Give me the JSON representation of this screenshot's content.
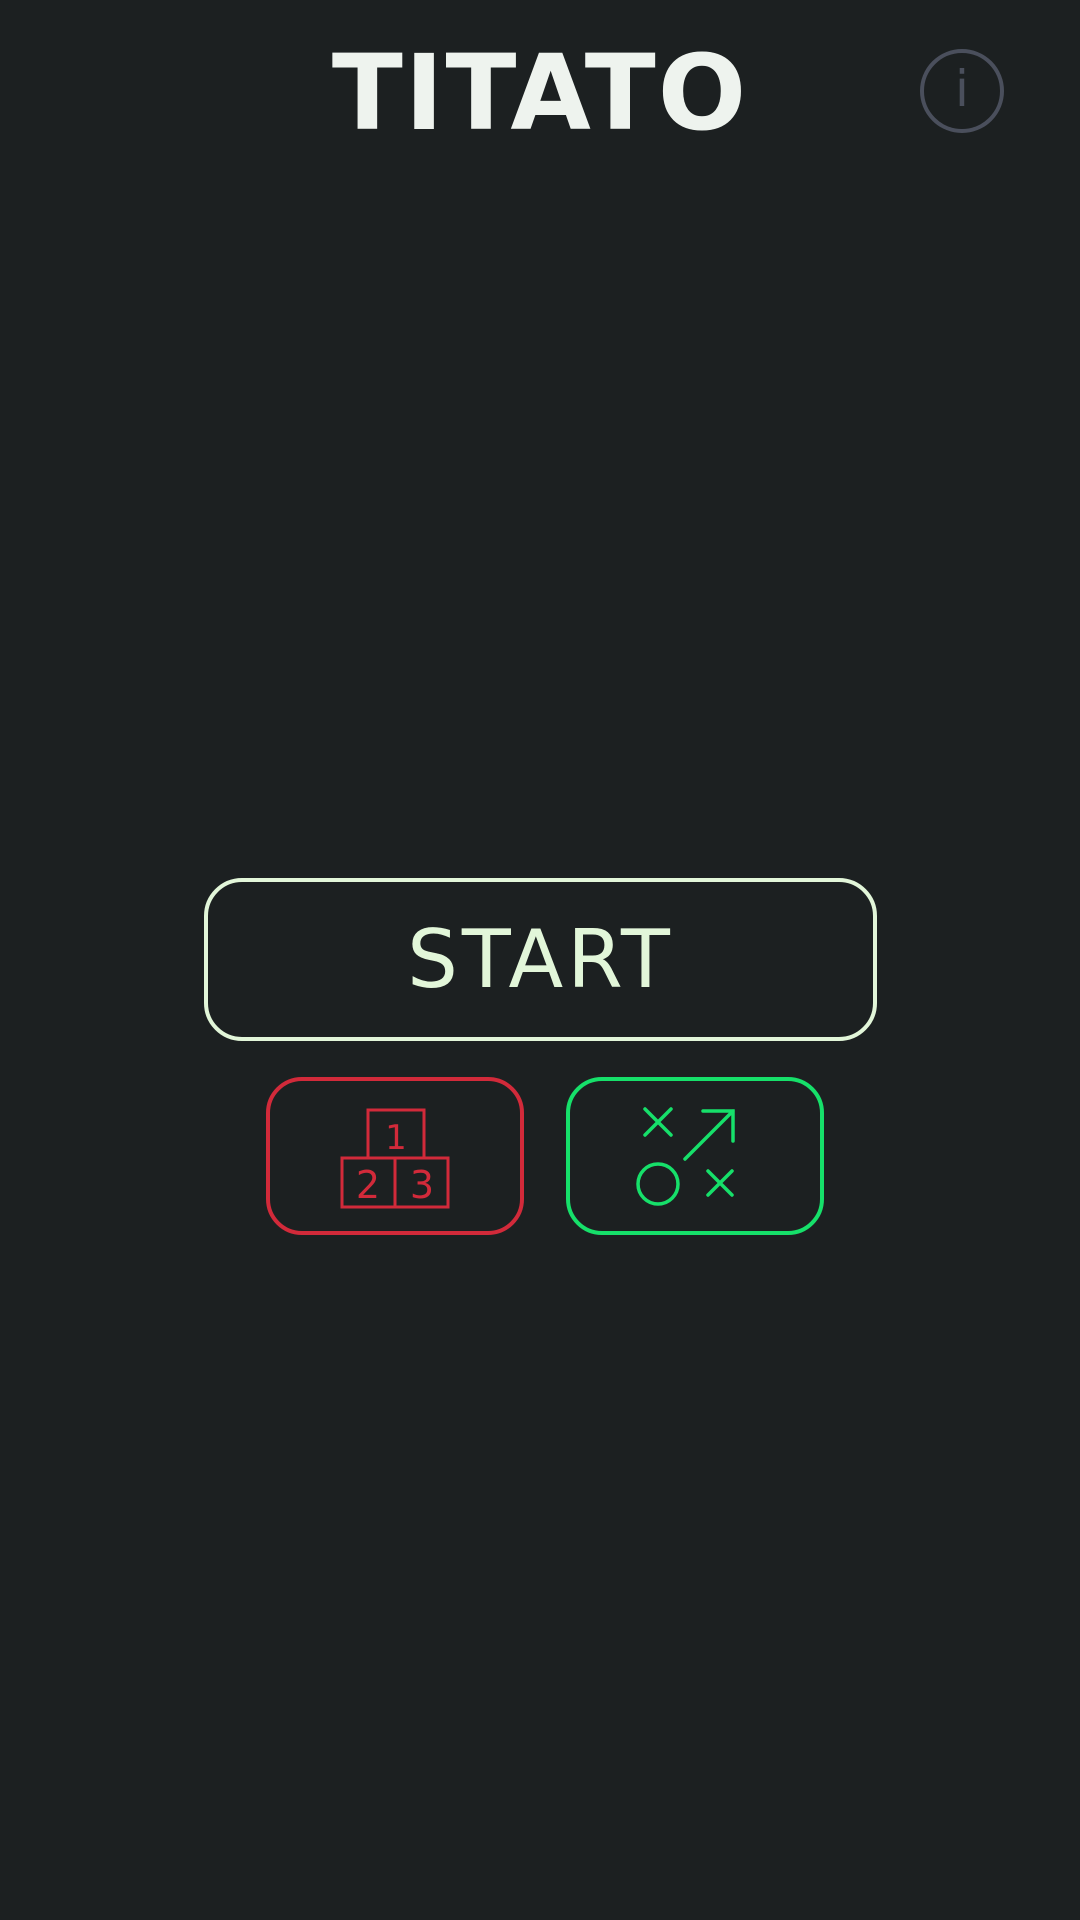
{
  "app": {
    "title": "TITATO"
  },
  "header": {
    "info_icon": "info-icon",
    "info_glyph": "i"
  },
  "main": {
    "start_label": "START",
    "leaderboard_icon": "podium-icon",
    "leaderboard_ranks": [
      "1",
      "2",
      "3"
    ],
    "strategy_icon": "tic-tac-toe-strategy-icon"
  },
  "colors": {
    "background": "#1c2021",
    "title": "#eef3ee",
    "info": "#4a4f5c",
    "start": "#e2f6d9",
    "leaderboard": "#d22a3a",
    "strategy": "#16e06a"
  }
}
